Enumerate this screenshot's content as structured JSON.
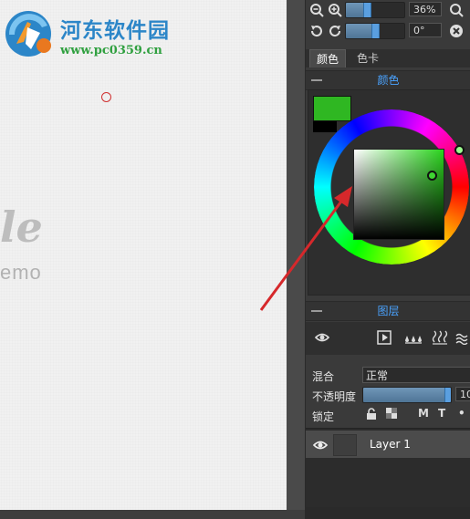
{
  "watermark": {
    "title": "河东软件园",
    "url": "www.pc0359.cn"
  },
  "canvas": {
    "script_text": "le",
    "caption_text": "emo"
  },
  "toolbar": {
    "zoom_value": "36%",
    "rotate_value": "0°",
    "zoom_fraction": 0.36,
    "rotate_fraction": 0.5
  },
  "tabs": [
    {
      "label": "颜色",
      "active": true
    },
    {
      "label": "色卡",
      "active": false
    }
  ],
  "color_panel": {
    "title": "颜色",
    "foreground": "#2fb722",
    "background": "#000000",
    "hue_color": "#2bd41e"
  },
  "layers_panel": {
    "title": "图层",
    "blend_label": "混合",
    "blend_value": "正常",
    "opacity_label": "不透明度",
    "opacity_value": "10",
    "opacity_fraction": 0.97,
    "lock_label": "锁定",
    "lock_letters": [
      "M",
      "T",
      "•"
    ]
  },
  "layers": [
    {
      "name": "Layer 1",
      "visible": true
    }
  ],
  "colors": {
    "accent": "#4aa3ff",
    "panel_bg": "#3a3a3a",
    "arrow": "#d6282b"
  }
}
